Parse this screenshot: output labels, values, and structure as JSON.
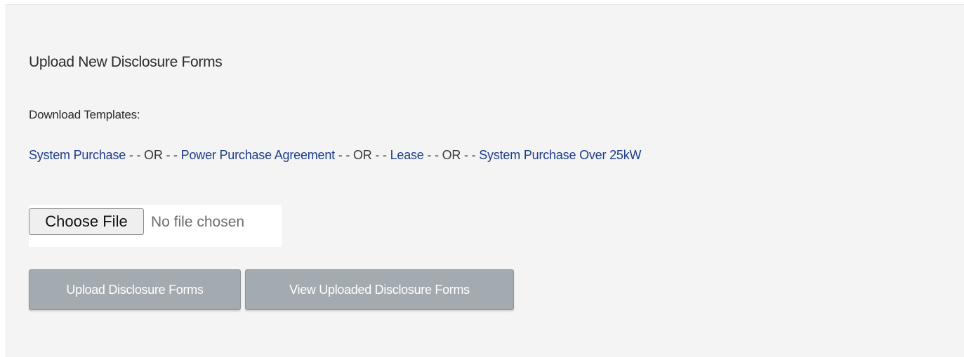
{
  "section": {
    "title": "Upload New Disclosure Forms",
    "download_label": "Download Templates:"
  },
  "templates": {
    "separator": " - - OR - - ",
    "links": [
      "System Purchase",
      "Power Purchase Agreement",
      "Lease",
      "System Purchase Over 25kW"
    ]
  },
  "file_input": {
    "button_label": "Choose File",
    "status": "No file chosen"
  },
  "actions": {
    "upload_label": "Upload Disclosure Forms",
    "view_label": "View Uploaded Disclosure Forms"
  },
  "colors": {
    "panel_background": "#f4f4f4",
    "link": "#1c3e8a",
    "button_disabled": "#a4abb0"
  }
}
